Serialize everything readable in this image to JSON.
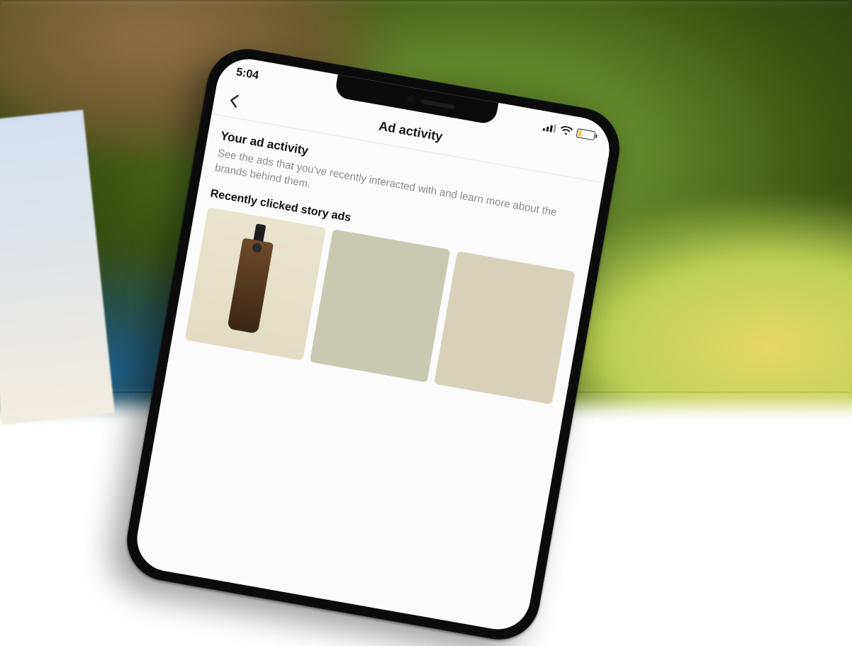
{
  "status": {
    "time": "5:04"
  },
  "navbar": {
    "title": "Ad activity"
  },
  "section": {
    "heading": "Your ad activity",
    "description": "See the ads that you've recently interacted with and learn more about the brands behind them.",
    "subheading": "Recently clicked story ads"
  }
}
